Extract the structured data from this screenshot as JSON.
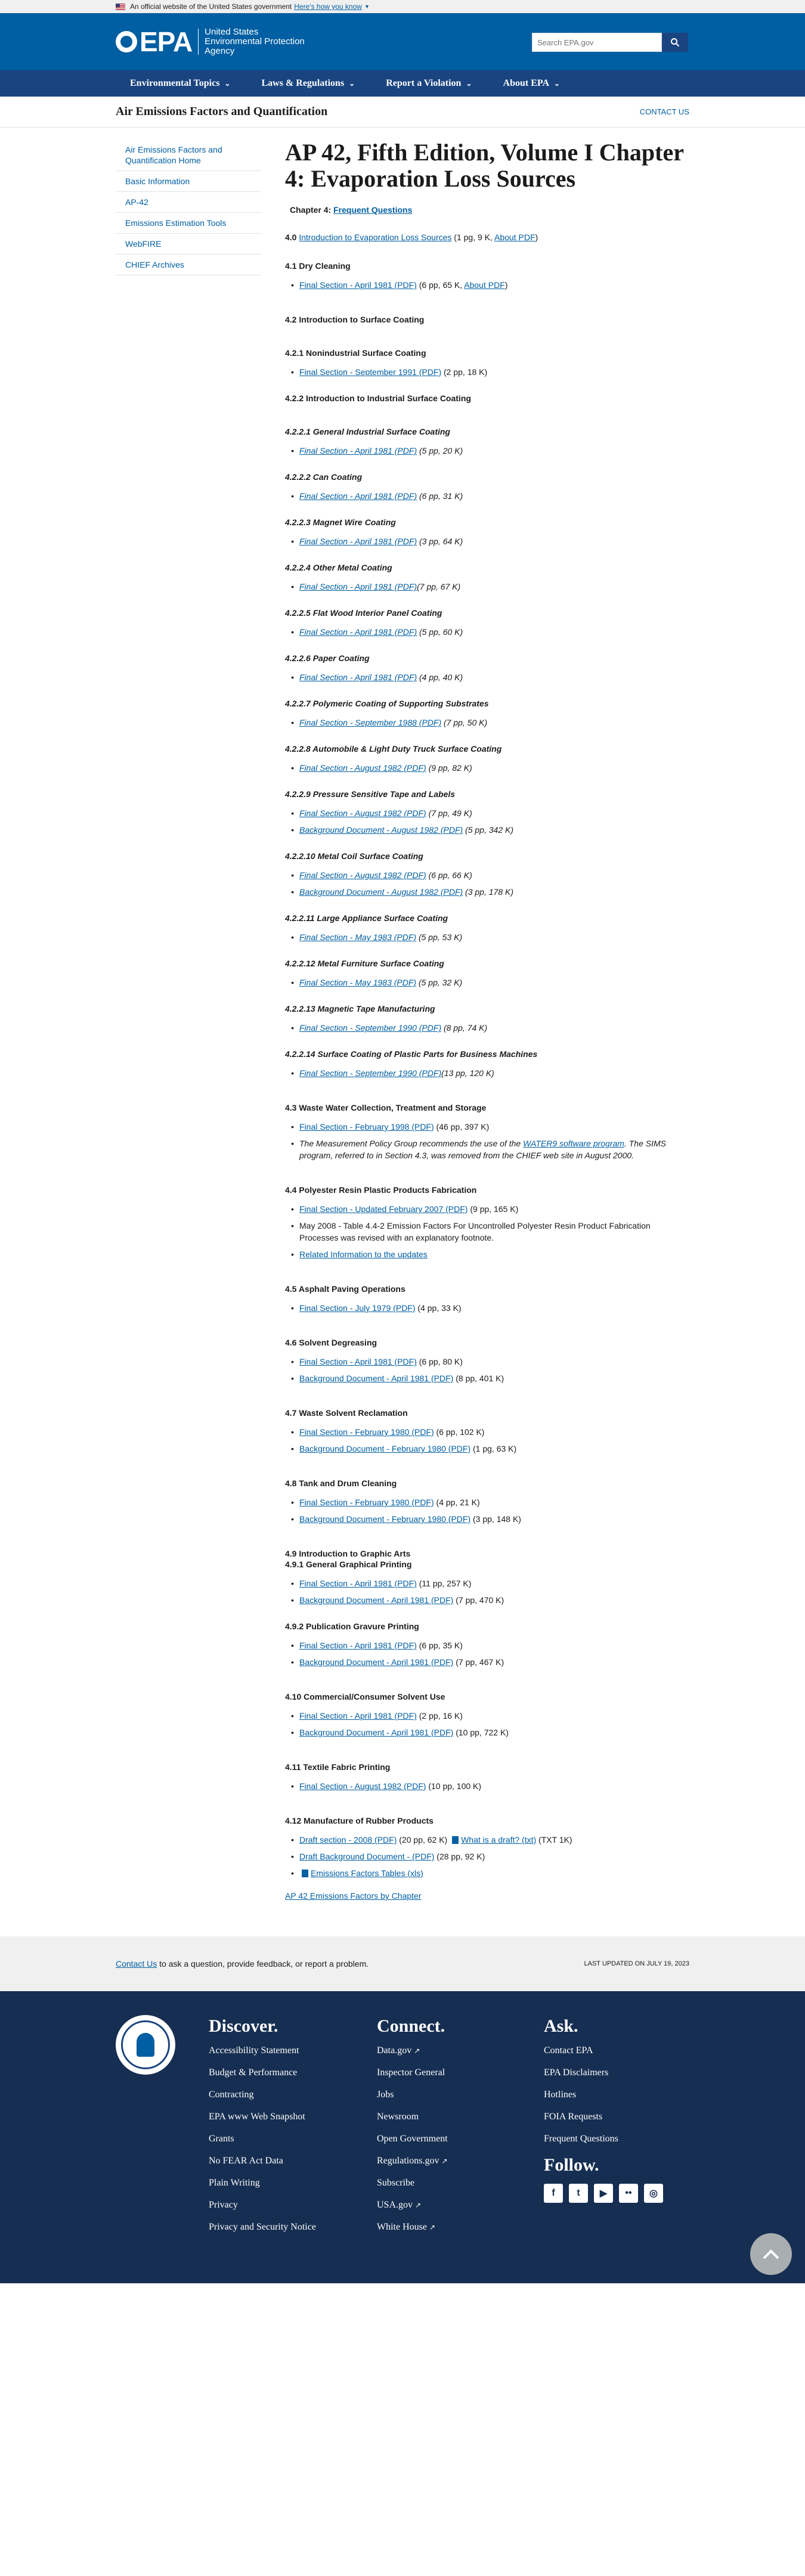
{
  "banner": {
    "text": "An official website of the United States government",
    "link": "Here's how you know"
  },
  "header": {
    "logo": "EPA",
    "agency_lines": [
      "United States",
      "Environmental Protection",
      "Agency"
    ],
    "search_placeholder": "Search EPA.gov",
    "nav": [
      "Environmental Topics",
      "Laws & Regulations",
      "Report a Violation",
      "About EPA"
    ]
  },
  "site": {
    "title": "Air Emissions Factors and Quantification",
    "contact": "CONTACT US"
  },
  "sidenav": [
    "Air Emissions Factors and Quantification Home",
    "Basic Information",
    "AP-42",
    "Emissions Estimation Tools",
    "WebFIRE",
    "CHIEF Archives"
  ],
  "page": {
    "title": "AP 42, Fifth Edition, Volume I Chapter 4: Evaporation Loss Sources",
    "chapter_label": "Chapter 4: ",
    "chapter_link": "Frequent Questions",
    "intro_num": "4.0 ",
    "intro_link": "Introduction to Evaporation Loss Sources",
    "intro_meta": " (1 pg, 9 K, ",
    "intro_about": "About PDF",
    "intro_close": ")",
    "s41": {
      "heading": "4.1 Dry Cleaning",
      "link": "Final Section - April 1981 (PDF)",
      "meta": " (6 pp, 65 K, ",
      "about": "About PDF",
      "close": ")"
    },
    "s42": "4.2 Introduction to Surface Coating",
    "s421": {
      "heading": "4.2.1 Nonindustrial Surface Coating",
      "link": "Final Section - September 1991 (PDF)",
      "meta": " (2 pp, 18 K)"
    },
    "s422": "4.2.2 Introduction to Industrial Surface Coating",
    "subs": [
      {
        "heading": "4.2.2.1 General Industrial Surface Coating",
        "items": [
          {
            "link": "Final Section - April 1981 (PDF)",
            "meta": " (5 pp, 20 K)"
          }
        ]
      },
      {
        "heading": "4.2.2.2 Can Coating",
        "items": [
          {
            "link": "Final Section - April 1981 (PDF)",
            "meta": " (6 pp, 31 K)"
          }
        ]
      },
      {
        "heading": "4.2.2.3 Magnet Wire Coating",
        "items": [
          {
            "link": "Final Section - April 1981 (PDF)",
            "meta": " (3 pp, 64 K)"
          }
        ]
      },
      {
        "heading": "4.2.2.4 Other Metal Coating",
        "items": [
          {
            "link": "Final Section - April 1981 (PDF)",
            "meta": "(7 pp, 67 K)"
          }
        ]
      },
      {
        "heading": "4.2.2.5 Flat Wood Interior Panel Coating",
        "items": [
          {
            "link": "Final Section - April 1981 (PDF)",
            "meta": " (5 pp, 60 K)"
          }
        ]
      },
      {
        "heading": "4.2.2.6 Paper Coating",
        "items": [
          {
            "link": "Final Section - April 1981 (PDF)",
            "meta": " (4 pp, 40 K)"
          }
        ]
      },
      {
        "heading": "4.2.2.7 Polymeric Coating of Supporting Substrates",
        "items": [
          {
            "link": "Final Section - September 1988 (PDF)",
            "meta": " (7 pp, 50 K)"
          }
        ]
      },
      {
        "heading": "4.2.2.8 Automobile & Light Duty Truck Surface Coating",
        "items": [
          {
            "link": "Final Section - August 1982 (PDF)",
            "meta": " (9 pp, 82 K)"
          }
        ]
      },
      {
        "heading": "4.2.2.9 Pressure Sensitive Tape and Labels",
        "items": [
          {
            "link": "Final Section - August 1982 (PDF)",
            "meta": " (7 pp, 49 K)"
          },
          {
            "link": "Background Document - August 1982 (PDF)",
            "meta": " (5 pp, 342 K)"
          }
        ]
      },
      {
        "heading": "4.2.2.10 Metal Coil Surface Coating",
        "items": [
          {
            "link": "Final Section - August 1982 (PDF)",
            "meta": " (6 pp, 66 K)"
          },
          {
            "link": "Background Document - August 1982 (PDF)",
            "meta": " (3 pp, 178 K)"
          }
        ]
      },
      {
        "heading": "4.2.2.11 Large Appliance Surface Coating",
        "items": [
          {
            "link": "Final Section - May 1983 (PDF)",
            "meta": " (5 pp, 53 K)"
          }
        ]
      },
      {
        "heading": "4.2.2.12 Metal Furniture Surface Coating",
        "items": [
          {
            "link": "Final Section - May 1983 (PDF)",
            "meta": " (5 pp, 32 K)"
          }
        ]
      },
      {
        "heading": "4.2.2.13 Magnetic Tape Manufacturing",
        "items": [
          {
            "link": "Final Section - September 1990 (PDF)",
            "meta": " (8 pp, 74 K)"
          }
        ]
      },
      {
        "heading": "4.2.2.14 Surface Coating of Plastic Parts for Business Machines",
        "items": [
          {
            "link": "Final Section - September 1990 (PDF)",
            "meta": "(13 pp, 120 K)"
          }
        ]
      }
    ],
    "s43": {
      "heading": "4.3 Waste Water Collection, Treatment and Storage",
      "link": "Final Section - February 1998 (PDF)",
      "meta": " (46 pp, 397 K)",
      "note_pre": "The Measurement Policy Group recommends the use of the ",
      "note_link": "WATER9 software program",
      "note_post": ". The SIMS program, referred to in Section 4.3, was removed from the CHIEF web site in August 2000."
    },
    "s44": {
      "heading": "4.4 Polyester Resin Plastic Products Fabrication",
      "link": "Final Section - Updated February 2007 (PDF)",
      "meta": " (9 pp, 165 K)",
      "note": "May 2008 - Table 4.4-2 Emission Factors For Uncontrolled Polyester Resin Product Fabrication Processes was revised with an explanatory footnote.",
      "related": "Related Information to the updates"
    },
    "s45": {
      "heading": "4.5 Asphalt Paving Operations",
      "link": "Final Section - July 1979 (PDF)",
      "meta": " (4 pp, 33 K)"
    },
    "s46": {
      "heading": "4.6 Solvent Degreasing",
      "items": [
        {
          "link": "Final Section - April 1981 (PDF)",
          "meta": " (6 pp, 80 K)"
        },
        {
          "link": "Background Document - April 1981 (PDF)",
          "meta": " (8 pp, 401 K)"
        }
      ]
    },
    "s47": {
      "heading": "4.7 Waste Solvent Reclamation",
      "items": [
        {
          "link": "Final Section - February 1980 (PDF)",
          "meta": " (6 pp, 102 K)"
        },
        {
          "link": "Background Document - February 1980 (PDF)",
          "meta": " (1 pg, 63 K)"
        }
      ]
    },
    "s48": {
      "heading": "4.8 Tank and Drum Cleaning",
      "items": [
        {
          "link": "Final Section - February 1980 (PDF)",
          "meta": " (4 pp, 21 K)"
        },
        {
          "link": "Background Document - February 1980 (PDF)",
          "meta": " (3 pp, 148 K)"
        }
      ]
    },
    "s49": {
      "heading": "4.9 Introduction to Graphic Arts",
      "sub1": "4.9.1 General Graphical Printing",
      "items1": [
        {
          "link": "Final Section - April 1981 (PDF)",
          "meta": " (11 pp, 257 K)"
        },
        {
          "link": "Background Document - April 1981 (PDF)",
          "meta": " (7 pp, 470 K)"
        }
      ],
      "sub2": "4.9.2 Publication Gravure Printing",
      "items2": [
        {
          "link": "Final Section - April 1981 (PDF)",
          "meta": " (6 pp, 35 K)"
        },
        {
          "link": "Background Document - April 1981 (PDF)",
          "meta": " (7 pp, 467 K)"
        }
      ]
    },
    "s410": {
      "heading": "4.10 Commercial/Consumer Solvent Use",
      "items": [
        {
          "link": "Final Section - April 1981 (PDF)",
          "meta": " (2 pp, 16 K)"
        },
        {
          "link": "Background Document - April 1981 (PDF)",
          "meta": " (10 pp, 722 K)"
        }
      ]
    },
    "s411": {
      "heading": "4.11 Textile Fabric Printing",
      "link": "Final Section - August 1982 (PDF)",
      "meta": " (10 pp, 100 K)"
    },
    "s412": {
      "heading": "4.12 Manufacture of Rubber Products",
      "draft_link": "Draft section - 2008 (PDF)",
      "draft_meta": " (20 pp, 62 K) ",
      "draft_q": "What is a draft? (txt)",
      "draft_q_meta": "  (TXT 1K)",
      "bg_link": "Draft Background Document - (PDF)",
      "bg_meta": " (28 pp, 92 K)",
      "xls_link": "Emissions Factors Tables (xls)"
    },
    "back_link": "AP 42 Emissions Factors by Chapter"
  },
  "feedback": {
    "link": "Contact Us",
    "text": " to ask a question, provide feedback, or report a problem.",
    "updated": "LAST UPDATED ON JULY 19, 2023"
  },
  "footer": {
    "discover": {
      "heading": "Discover.",
      "links": [
        "Accessibility Statement",
        "Budget & Performance",
        "Contracting",
        "EPA www Web Snapshot",
        "Grants",
        "No FEAR Act Data",
        "Plain Writing",
        "Privacy",
        "Privacy and Security Notice"
      ]
    },
    "connect": {
      "heading": "Connect.",
      "links": [
        "Data.gov",
        "Inspector General",
        "Jobs",
        "Newsroom",
        "Open Government",
        "Regulations.gov",
        "Subscribe",
        "USA.gov",
        "White House"
      ]
    },
    "ask": {
      "heading": "Ask.",
      "links": [
        "Contact EPA",
        "EPA Disclaimers",
        "Hotlines",
        "FOIA Requests",
        "Frequent Questions"
      ]
    },
    "follow": {
      "heading": "Follow."
    }
  },
  "icons": {
    "search": "search-icon",
    "back_to_top": "arrow-up-icon",
    "external": "external-link-icon"
  }
}
